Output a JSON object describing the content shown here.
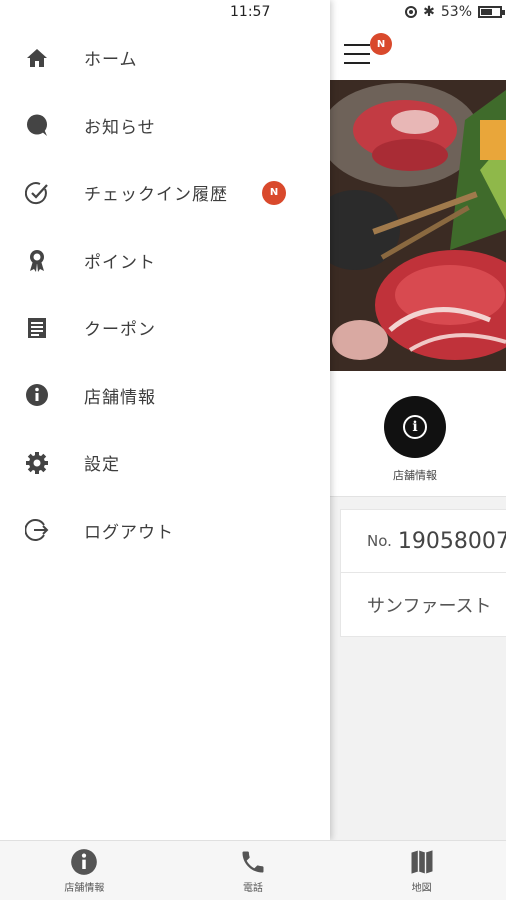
{
  "status_bar": {
    "time": "11:57",
    "battery": "53%"
  },
  "drawer": {
    "items": [
      {
        "label": "ホーム",
        "icon": "home-icon"
      },
      {
        "label": "お知らせ",
        "icon": "chat-bubble-icon"
      },
      {
        "label": "チェックイン履歴",
        "icon": "check-circle-icon",
        "badge": "N"
      },
      {
        "label": "ポイント",
        "icon": "award-ribbon-icon"
      },
      {
        "label": "クーポン",
        "icon": "coupon-list-icon"
      },
      {
        "label": "店舗情報",
        "icon": "info-icon"
      },
      {
        "label": "設定",
        "icon": "gear-icon"
      },
      {
        "label": "ログアウト",
        "icon": "logout-icon"
      }
    ]
  },
  "app": {
    "menu_badge": "N",
    "shop_info_label": "店舗情報",
    "member_no_label": "No.",
    "member_no_value": "19058007",
    "member_name": "サンファースト"
  },
  "tabbar": {
    "tabs": [
      {
        "label": "店舗情報",
        "icon": "info-icon"
      },
      {
        "label": "電話",
        "icon": "phone-icon"
      },
      {
        "label": "地図",
        "icon": "map-icon"
      }
    ]
  },
  "colors": {
    "badge": "#d9492c",
    "drawer_bg": "#ffffff",
    "tabbar_bg": "#f6f6f6"
  }
}
